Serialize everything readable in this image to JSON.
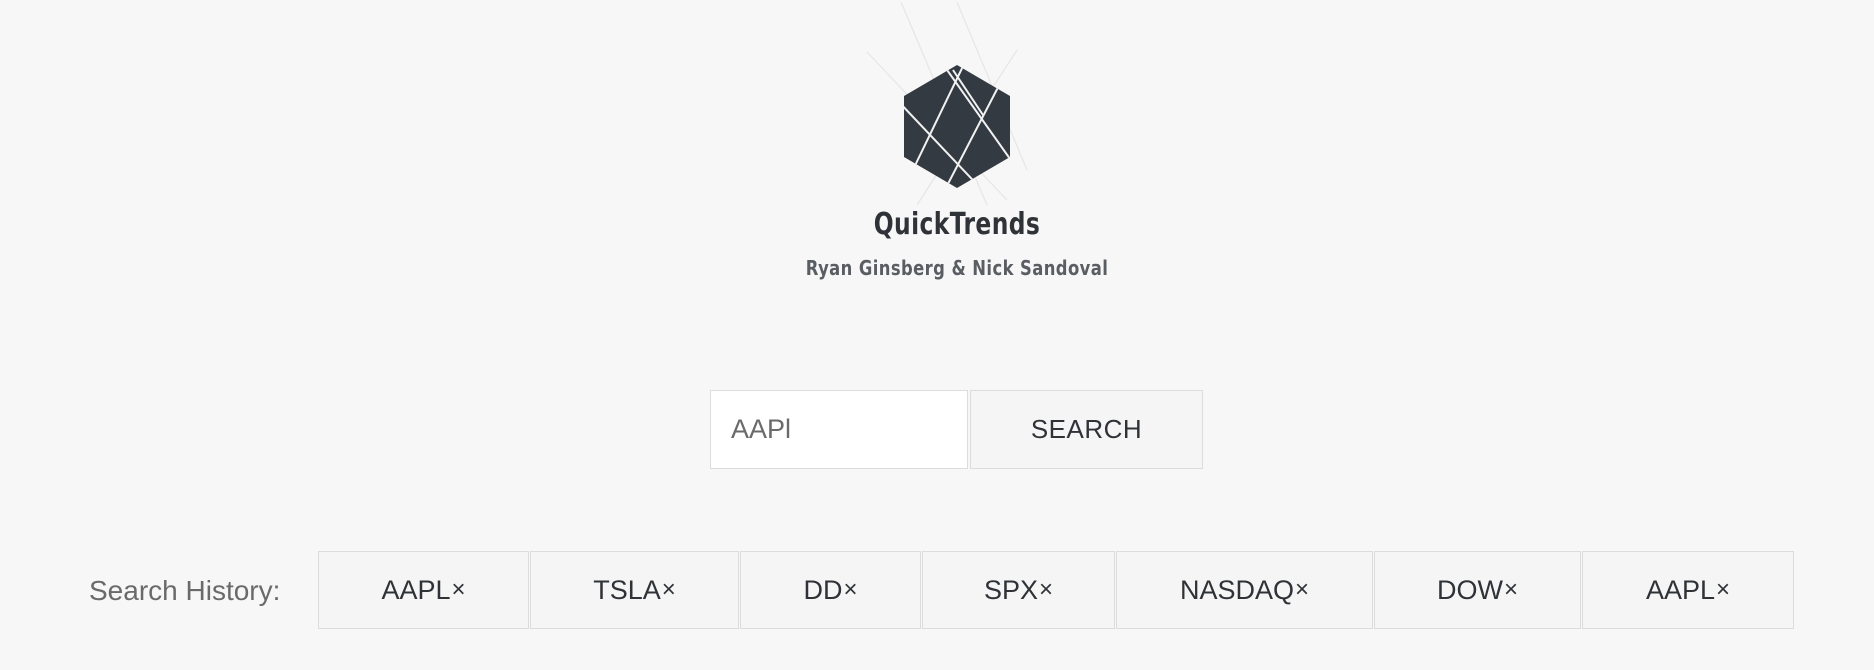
{
  "header": {
    "title": "QuickTrends",
    "authors": "Ryan Ginsberg & Nick Sandoval",
    "logo_icon": "hexagon-geometric-logo-icon"
  },
  "search": {
    "value": "AAPl",
    "placeholder": "",
    "button_label": "SEARCH"
  },
  "history": {
    "label": "Search History:",
    "close_glyph": "×",
    "items": [
      {
        "label": "AAPL"
      },
      {
        "label": "TSLA"
      },
      {
        "label": "DD"
      },
      {
        "label": "SPX"
      },
      {
        "label": "NASDAQ"
      },
      {
        "label": "DOW"
      },
      {
        "label": "AAPL"
      }
    ]
  },
  "colors": {
    "background": "#f7f7f7",
    "logo_fill": "#343a42",
    "text_dark": "#2f3237",
    "text_muted": "#6a6a6a",
    "border": "#dcdcdc"
  }
}
